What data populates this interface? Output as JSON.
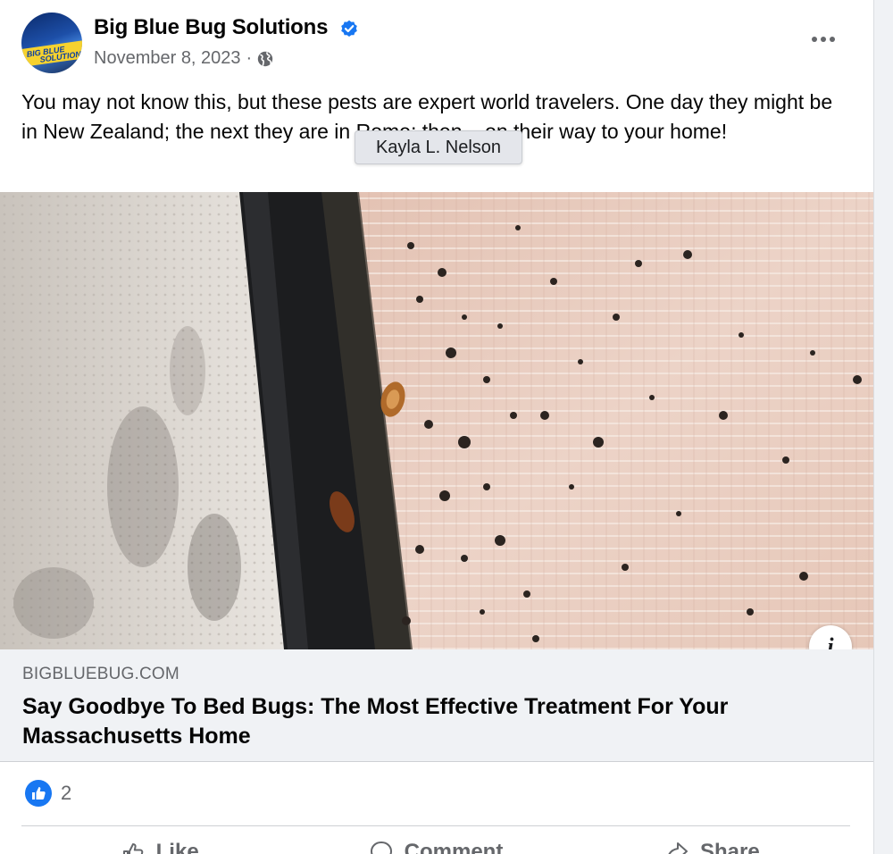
{
  "post": {
    "page_name": "Big Blue Bug Solutions",
    "avatar_text_line1": "BIG BLUE",
    "avatar_text_line2": "SOLUTIONS",
    "date": "November 8, 2023",
    "separator": "·",
    "privacy_icon": "globe-icon",
    "verified_icon": "verified-badge-icon",
    "more_icon": "more-options-icon",
    "text": "You may not know this, but these pests are expert world travelers. One day they might be in New Zealand; the next they are in Rome; then... on their way to your home!",
    "tooltip": "Kayla L. Nelson"
  },
  "link_preview": {
    "info_icon": "info-icon",
    "info_label": "i",
    "domain": "BIGBLUEBUG.COM",
    "headline": "Say Goodbye To Bed Bugs: The Most Effective Treatment For Your Massachusetts Home"
  },
  "engagement": {
    "like_icon": "like-reaction-icon",
    "reaction_count": "2",
    "actions": [
      {
        "label": "Like",
        "icon": "thumbs-up-icon"
      },
      {
        "label": "Comment",
        "icon": "comment-icon"
      },
      {
        "label": "Share",
        "icon": "share-icon"
      }
    ]
  },
  "colors": {
    "facebook_blue": "#1877f2",
    "secondary_text": "#65676b",
    "link_box_bg": "#f0f2f5"
  }
}
